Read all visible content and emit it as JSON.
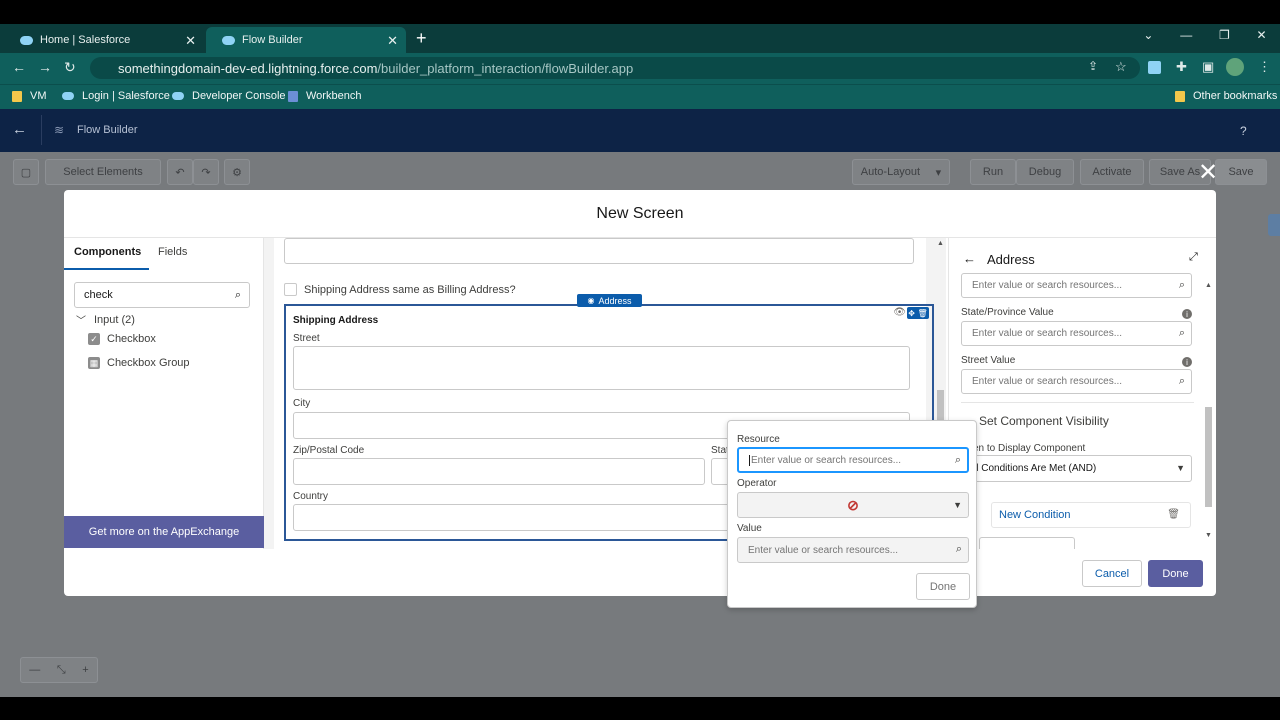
{
  "browser": {
    "tabs": [
      {
        "title": "Home | Salesforce"
      },
      {
        "title": "Flow Builder"
      }
    ],
    "url_domain": "somethingdomain-dev-ed.lightning.force.com",
    "url_path": "/builder_platform_interaction/flowBuilder.app",
    "bookmarks": [
      "VM",
      "Login | Salesforce",
      "Developer Console",
      "Workbench"
    ],
    "other_bookmarks": "Other bookmarks"
  },
  "header": {
    "app_title": "Flow Builder",
    "help": "?"
  },
  "toolbar": {
    "select_elements": "Select Elements",
    "layout_mode": "Auto-Layout",
    "run": "Run",
    "debug": "Debug",
    "activate": "Activate",
    "save_as": "Save As",
    "save": "Save"
  },
  "modal": {
    "title": "New Screen",
    "left": {
      "tab_components": "Components",
      "tab_fields": "Fields",
      "search_value": "check",
      "group_label": "Input (2)",
      "items": [
        "Checkbox",
        "Checkbox Group"
      ],
      "appexchange": "Get more on the AppExchange"
    },
    "canvas": {
      "checkbox_label": "Shipping Address same as Billing Address?",
      "badge": "Address",
      "section_title": "Shipping Address",
      "street": "Street",
      "city": "City",
      "zip": "Zip/Postal Code",
      "state": "State/",
      "country": "Country"
    },
    "right": {
      "title": "Address",
      "placeholder": "Enter value or search resources...",
      "state_label": "State/Province Value",
      "street_label": "Street Value",
      "visibility_section": "Set Component Visibility",
      "when_label": "en to Display Component",
      "condition_select": "ll Conditions Are Met (AND)",
      "new_condition": "New Condition"
    },
    "cancel": "Cancel",
    "done": "Done"
  },
  "popover": {
    "resource_label": "Resource",
    "resource_placeholder": "Enter value or search resources...",
    "operator_label": "Operator",
    "value_label": "Value",
    "value_placeholder": "Enter value or search resources...",
    "done": "Done"
  }
}
